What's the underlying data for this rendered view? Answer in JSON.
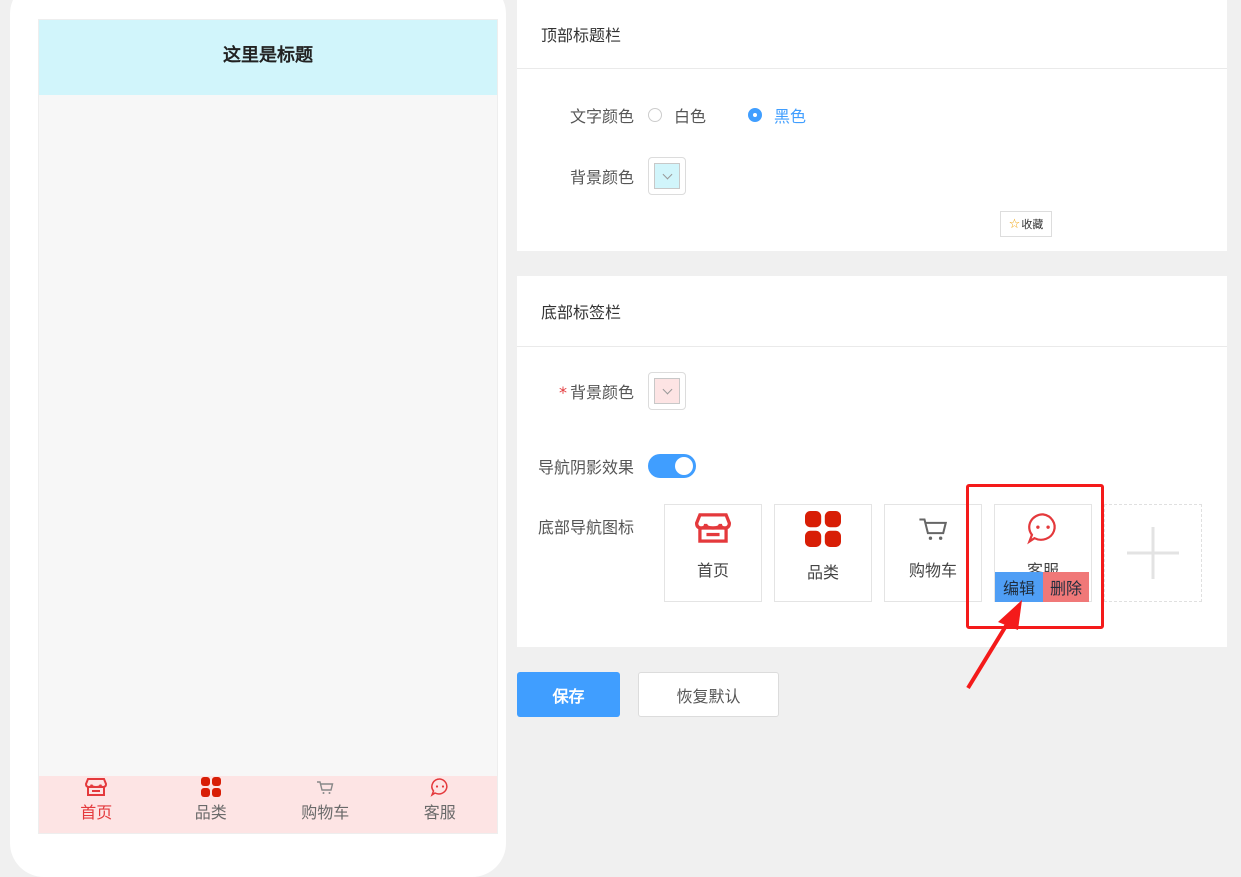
{
  "preview": {
    "title": "这里是标题",
    "header_bg": "#d1f5fb",
    "tabbar_bg": "#fde4e4",
    "tabs": [
      {
        "label": "首页",
        "icon": "storefront-icon",
        "active": true
      },
      {
        "label": "品类",
        "icon": "grid-icon",
        "active": false
      },
      {
        "label": "购物车",
        "icon": "cart-icon",
        "active": false
      },
      {
        "label": "客服",
        "icon": "chat-bubble-icon",
        "active": false
      }
    ]
  },
  "top_bar": {
    "heading": "顶部标题栏",
    "text_color_label": "文字颜色",
    "options": [
      {
        "label": "白色",
        "checked": false
      },
      {
        "label": "黑色",
        "checked": true
      }
    ],
    "bg_color_label": "背景颜色",
    "bg_color": "#d1f5fb"
  },
  "favorite": {
    "label": "收藏",
    "icon": "star-icon"
  },
  "bottom_bar": {
    "heading": "底部标签栏",
    "bg_color_label": "背景颜色",
    "required_mark": "*",
    "bg_color": "#fde4e4",
    "shadow_label": "导航阴影效果",
    "shadow_enabled": true,
    "icons_label": "底部导航图标",
    "nav_items": [
      {
        "label": "首页",
        "icon": "storefront-icon"
      },
      {
        "label": "品类",
        "icon": "grid-icon"
      },
      {
        "label": "购物车",
        "icon": "cart-icon"
      },
      {
        "label": "客服",
        "icon": "chat-bubble-icon"
      }
    ],
    "edit_label": "编辑",
    "delete_label": "删除",
    "add_icon": "plus-icon"
  },
  "actions": {
    "save_label": "保存",
    "reset_label": "恢复默认"
  },
  "colors": {
    "accent": "#409eff",
    "brand_red": "#e4393c",
    "annotation": "#f41a1a"
  }
}
